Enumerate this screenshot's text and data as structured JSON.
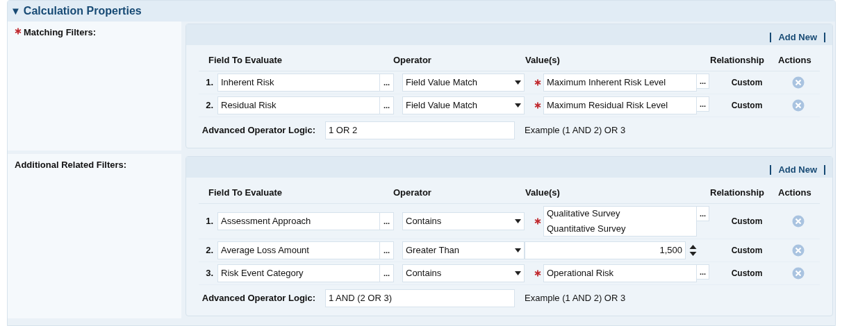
{
  "section": {
    "title": "Calculation Properties",
    "expanded": true,
    "toggle": "▼"
  },
  "filter_groups": [
    {
      "label": "Matching Filters:",
      "required": true,
      "add_new": "Add New",
      "columns": [
        "Field To Evaluate",
        "Operator",
        "Value(s)",
        "Relationship",
        "Actions"
      ],
      "rows": [
        {
          "number": "1.",
          "field": "Inherent Risk",
          "field_button": "...",
          "operator": "Field Value Match",
          "kind": "lookup",
          "required": true,
          "values": [
            "Maximum Inherent Risk Level"
          ],
          "value_button": "...",
          "relationship": "Custom"
        },
        {
          "number": "2.",
          "field": "Residual Risk",
          "field_button": "...",
          "operator": "Field Value Match",
          "kind": "lookup",
          "required": true,
          "values": [
            "Maximum Residual Risk Level"
          ],
          "value_button": "...",
          "relationship": "Custom"
        }
      ],
      "logic_label": "Advanced Operator Logic:",
      "logic_value": "1 OR 2",
      "logic_example": "Example (1 AND 2) OR 3"
    },
    {
      "label": "Additional Related Filters:",
      "required": false,
      "add_new": "Add New",
      "columns": [
        "Field To Evaluate",
        "Operator",
        "Value(s)",
        "Relationship",
        "Actions"
      ],
      "rows": [
        {
          "number": "1.",
          "field": "Assessment Approach",
          "field_button": "...",
          "operator": "Contains",
          "kind": "lookup",
          "required": true,
          "values": [
            "Qualitative Survey",
            "Quantitative Survey"
          ],
          "value_button": "...",
          "relationship": "Custom"
        },
        {
          "number": "2.",
          "field": "Average Loss Amount",
          "field_button": "...",
          "operator": "Greater Than",
          "kind": "number",
          "required": false,
          "values": [
            "1,500"
          ],
          "relationship": "Custom"
        },
        {
          "number": "3.",
          "field": "Risk Event Category",
          "field_button": "...",
          "operator": "Contains",
          "kind": "lookup",
          "required": true,
          "values": [
            "Operational Risk"
          ],
          "value_button": "...",
          "relationship": "Custom"
        }
      ],
      "logic_label": "Advanced Operator Logic:",
      "logic_value": "1 AND (2 OR 3)",
      "logic_example": "Example (1 AND 2) OR 3"
    }
  ]
}
